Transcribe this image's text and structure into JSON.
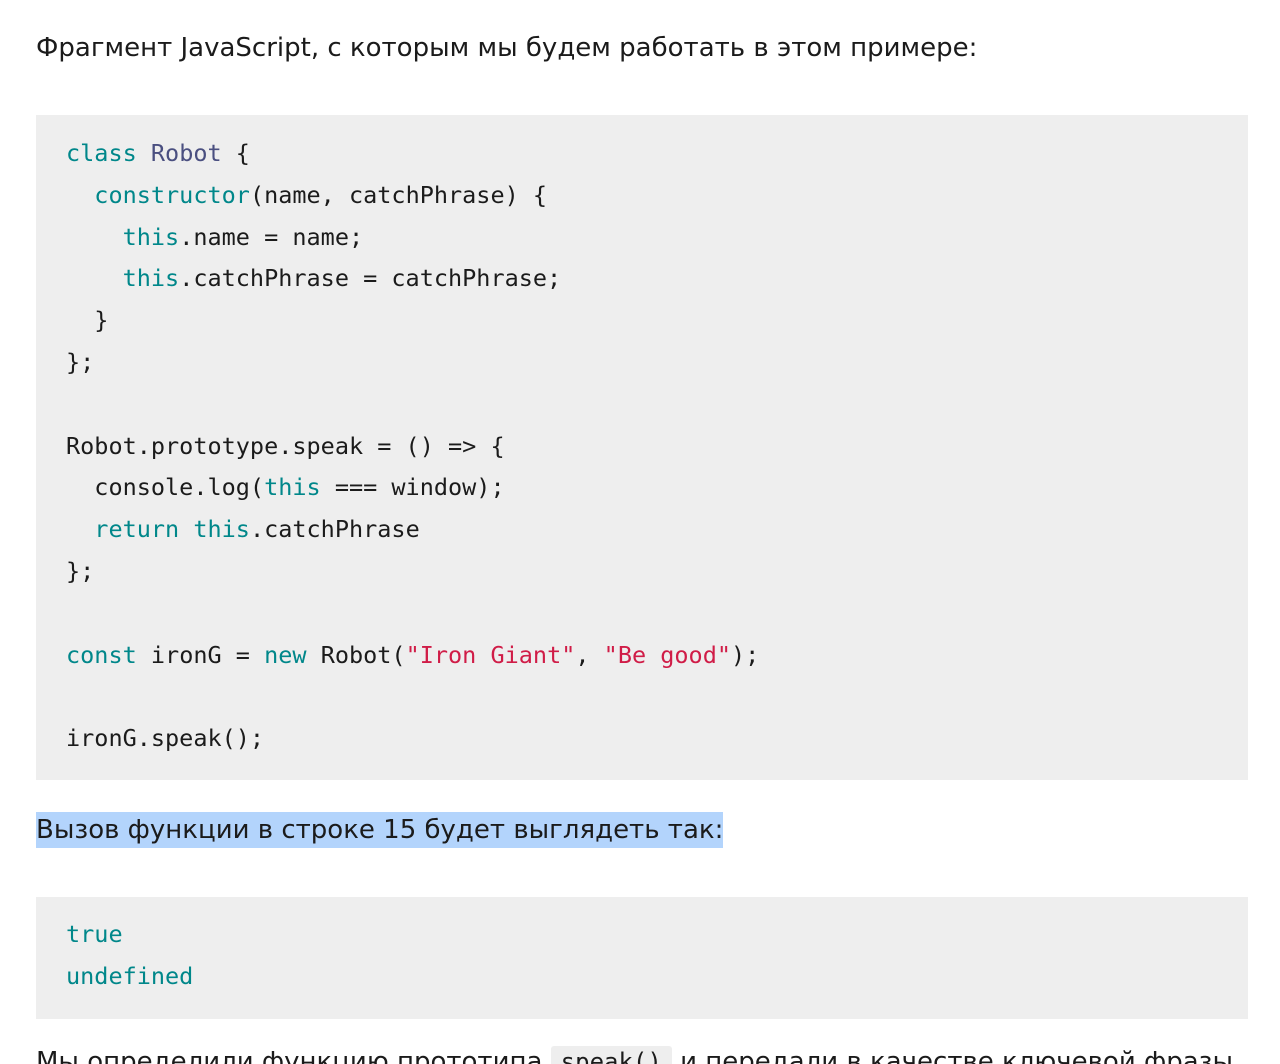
{
  "intro_text": "Фрагмент JavaScript, с которым мы будем работать в этом примере:",
  "code": {
    "l1": {
      "kw": "class",
      "cls": "Robot",
      "rest": " {"
    },
    "l2": {
      "indent": "  ",
      "kw": "constructor",
      "rest": "(name, catchPhrase) {"
    },
    "l3": {
      "indent": "    ",
      "kw": "this",
      "rest": ".name = name;"
    },
    "l4": {
      "indent": "    ",
      "kw": "this",
      "rest": ".catchPhrase = catchPhrase;"
    },
    "l5": "  }",
    "l6": "};",
    "l7": "Robot.prototype.speak = () => {",
    "l8": {
      "pre": "  console.log(",
      "kw": "this",
      "rest": " === window);"
    },
    "l9": {
      "indent": "  ",
      "kw1": "return",
      "kw2": "this",
      "rest": ".catchPhrase"
    },
    "l10": "};",
    "l11": {
      "kw1": "const",
      "mid": " ironG = ",
      "kw2": "new",
      "mid2": " Robot(",
      "s1": "\"Iron Giant\"",
      "comma": ", ",
      "s2": "\"Be good\"",
      "end": ");"
    },
    "l12": "ironG.speak();"
  },
  "caption_text": "Вызов функции в строке 15 будет выглядеть так:",
  "output": {
    "line1": "true",
    "line2": "undefined"
  },
  "bottom": {
    "before": "Мы определили функцию прототипа ",
    "inline_code": "speak()",
    "after": " и передали в качестве ключевой фразы"
  },
  "colors": {
    "keyword": "#00878a",
    "class_name": "#4a4f80",
    "string": "#d01c47",
    "code_bg": "#eeeeee",
    "selection": "#b3d4fc"
  }
}
